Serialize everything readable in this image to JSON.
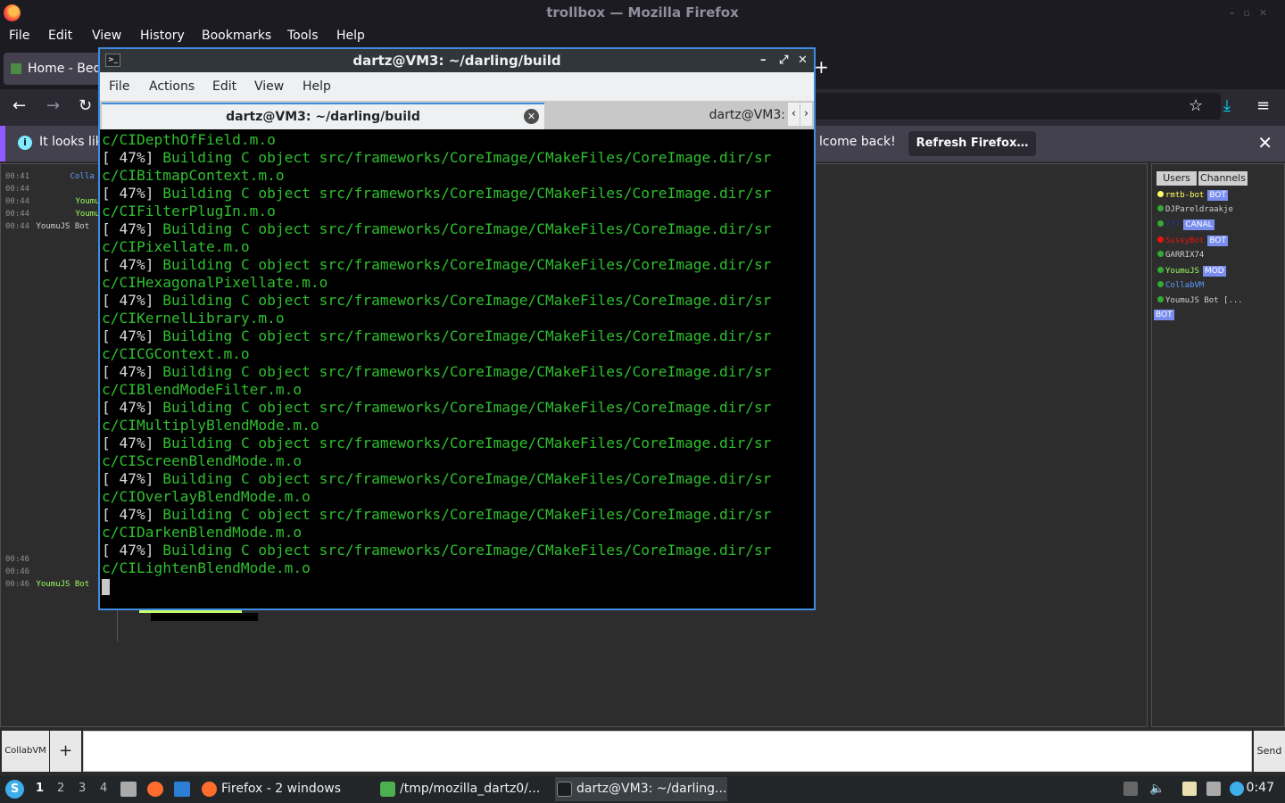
{
  "firefox": {
    "window_title": "trollbox — Mozilla Firefox",
    "menu": [
      "File",
      "Edit",
      "View",
      "History",
      "Bookmarks",
      "Tools",
      "Help"
    ],
    "tab_title": "Home - Bed",
    "notification_left": "It looks lik",
    "notification_right": "lcome back!",
    "refresh_button": "Refresh Firefox…"
  },
  "collabvm": {
    "log_top": [
      {
        "time": "00:41",
        "nick": "Colla",
        "cls": ""
      },
      {
        "time": "00:44",
        "nick": "",
        "cls": ""
      },
      {
        "time": "00:44",
        "nick": "Youmu",
        "cls": "g"
      },
      {
        "time": "00:44",
        "nick": "Youmu",
        "cls": "g"
      },
      {
        "time": "00:44",
        "nick": "YoumuJS Bot",
        "cls": "w"
      }
    ],
    "log_bottom": [
      {
        "time": "00:46",
        "nick": "",
        "cls": ""
      },
      {
        "time": "00:46",
        "nick": "",
        "cls": ""
      },
      {
        "time": "00:46",
        "nick": "YoumuJS Bot",
        "cls": "g"
      }
    ],
    "tabs": {
      "users": "Users",
      "channels": "Channels"
    },
    "users": [
      {
        "name": "rmtb-bot",
        "color": "#ffff66",
        "dot": "#ffff66",
        "badge": "BOT"
      },
      {
        "name": "DJPareldraakje",
        "color": "#d0d0d0",
        "dot": "#3a3",
        "badge": ""
      },
      {
        "name": "???",
        "color": "#2233aa",
        "dot": "#3a3",
        "badge": "CANAL"
      },
      {
        "name": "SussyBot",
        "color": "#ee1111",
        "dot": "#ee1111",
        "badge": "BOT"
      },
      {
        "name": "GARRIX74",
        "color": "#d0d0d0",
        "dot": "#3a3",
        "badge": ""
      },
      {
        "name": "YoumuJS",
        "color": "#9cff5f",
        "dot": "#3a3",
        "badge": "MOD"
      },
      {
        "name": "CollabVM",
        "color": "#5f9cff",
        "dot": "#3a3",
        "badge": ""
      },
      {
        "name": "YoumuJS Bot [...",
        "color": "#d0d0d0",
        "dot": "#3a3",
        "badge": ""
      }
    ],
    "last_user_badge": "BOT",
    "vm_tab": "CollabVM",
    "add_tab": "+",
    "send": "Send"
  },
  "terminal": {
    "title": "dartz@VM3: ~/darling/build",
    "menu": [
      "File",
      "Actions",
      "Edit",
      "View",
      "Help"
    ],
    "tab1": "dartz@VM3: ~/darling/build",
    "tab2": "dartz@VM3:",
    "first_line": "c/CIDepthOfField.m.o",
    "pct": "[ 47%]",
    "build_prefix": " Building C object src/frameworks/CoreImage/CMakeFiles/CoreImage.dir/sr",
    "objects": [
      "c/CIBitmapContext.m.o",
      "c/CIFilterPlugIn.m.o",
      "c/CIPixellate.m.o",
      "c/CIHexagonalPixellate.m.o",
      "c/CIKernelLibrary.m.o",
      "c/CICGContext.m.o",
      "c/CIBlendModeFilter.m.o",
      "c/CIMultiplyBlendMode.m.o",
      "c/CIScreenBlendMode.m.o",
      "c/CIOverlayBlendMode.m.o",
      "c/CIDarkenBlendMode.m.o",
      "c/CILightenBlendMode.m.o"
    ]
  },
  "taskbar": {
    "workspaces": [
      "1",
      "2",
      "3",
      "4"
    ],
    "task_firefox": "Firefox - 2 windows",
    "task_tmp": "/tmp/mozilla_dartz0/...",
    "task_term": "dartz@VM3: ~/darling...",
    "clock": "0:47"
  }
}
